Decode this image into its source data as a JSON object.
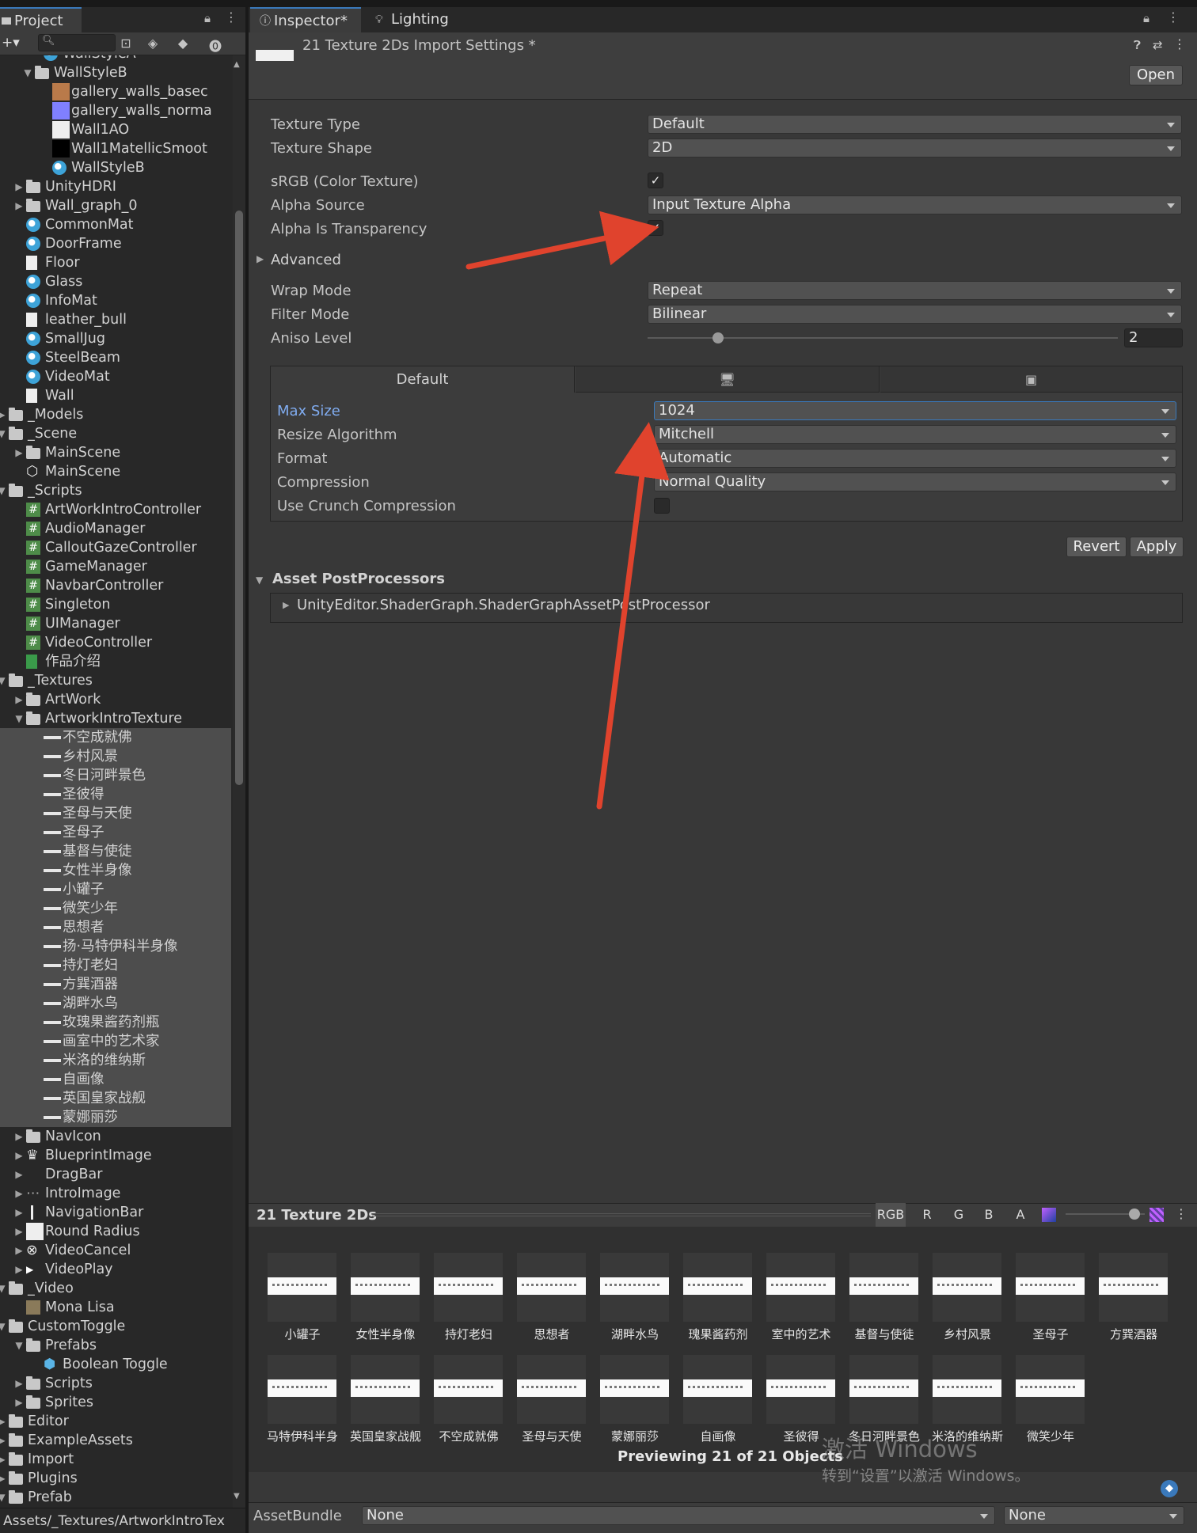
{
  "project": {
    "tab": "Project",
    "search_placeholder": "",
    "path": "Assets/_Textures/ArtworkIntroTex"
  },
  "tree": [
    {
      "label": "WallStyleA",
      "indent": 5,
      "icon": "mat",
      "arrow": ""
    },
    {
      "label": "WallStyleB",
      "indent": 4,
      "icon": "folder-open",
      "arrow": "down"
    },
    {
      "label": "gallery_walls_basec",
      "indent": 6,
      "icon": "sw-brown",
      "arrow": ""
    },
    {
      "label": "gallery_walls_norma",
      "indent": 6,
      "icon": "sw-blue",
      "arrow": ""
    },
    {
      "label": "Wall1AO",
      "indent": 6,
      "icon": "sw-white",
      "arrow": ""
    },
    {
      "label": "Wall1MatellicSmoot",
      "indent": 6,
      "icon": "sw-black",
      "arrow": ""
    },
    {
      "label": "WallStyleB",
      "indent": 6,
      "icon": "mat",
      "arrow": ""
    },
    {
      "label": "UnityHDRI",
      "indent": 3,
      "icon": "folder",
      "arrow": "right"
    },
    {
      "label": "Wall_graph_0",
      "indent": 3,
      "icon": "folder",
      "arrow": "right"
    },
    {
      "label": "CommonMat",
      "indent": 3,
      "icon": "mat",
      "arrow": ""
    },
    {
      "label": "DoorFrame",
      "indent": 3,
      "icon": "mat",
      "arrow": ""
    },
    {
      "label": "Floor",
      "indent": 3,
      "icon": "file",
      "arrow": ""
    },
    {
      "label": "Glass",
      "indent": 3,
      "icon": "mat",
      "arrow": ""
    },
    {
      "label": "InfoMat",
      "indent": 3,
      "icon": "mat",
      "arrow": ""
    },
    {
      "label": "leather_bull",
      "indent": 3,
      "icon": "file",
      "arrow": ""
    },
    {
      "label": "SmallJug",
      "indent": 3,
      "icon": "mat",
      "arrow": ""
    },
    {
      "label": "SteelBeam",
      "indent": 3,
      "icon": "mat",
      "arrow": ""
    },
    {
      "label": "VideoMat",
      "indent": 3,
      "icon": "mat",
      "arrow": ""
    },
    {
      "label": "Wall",
      "indent": 3,
      "icon": "file",
      "arrow": ""
    },
    {
      "label": "_Models",
      "indent": 1,
      "icon": "folder",
      "arrow": "right"
    },
    {
      "label": "_Scene",
      "indent": 1,
      "icon": "folder-open",
      "arrow": "down"
    },
    {
      "label": "MainScene",
      "indent": 3,
      "icon": "folder",
      "arrow": "right"
    },
    {
      "label": "MainScene",
      "indent": 3,
      "icon": "unity",
      "arrow": ""
    },
    {
      "label": "_Scripts",
      "indent": 1,
      "icon": "folder-open",
      "arrow": "down"
    },
    {
      "label": "ArtWorkIntroController",
      "indent": 3,
      "icon": "script",
      "arrow": ""
    },
    {
      "label": "AudioManager",
      "indent": 3,
      "icon": "script",
      "arrow": ""
    },
    {
      "label": "CalloutGazeController",
      "indent": 3,
      "icon": "script",
      "arrow": ""
    },
    {
      "label": "GameManager",
      "indent": 3,
      "icon": "script",
      "arrow": ""
    },
    {
      "label": "NavbarController",
      "indent": 3,
      "icon": "script",
      "arrow": ""
    },
    {
      "label": "Singleton",
      "indent": 3,
      "icon": "script",
      "arrow": ""
    },
    {
      "label": "UIManager",
      "indent": 3,
      "icon": "script",
      "arrow": ""
    },
    {
      "label": "VideoController",
      "indent": 3,
      "icon": "script",
      "arrow": ""
    },
    {
      "label": "作品介绍",
      "indent": 3,
      "icon": "sheet",
      "arrow": ""
    },
    {
      "label": "_Textures",
      "indent": 1,
      "icon": "folder-open",
      "arrow": "down"
    },
    {
      "label": "ArtWork",
      "indent": 3,
      "icon": "folder",
      "arrow": "right"
    },
    {
      "label": "ArtworkIntroTexture",
      "indent": 3,
      "icon": "folder-open",
      "arrow": "down"
    },
    {
      "label": "不空成就佛",
      "indent": 5,
      "icon": "dash",
      "arrow": "",
      "sel": true
    },
    {
      "label": "乡村风景",
      "indent": 5,
      "icon": "dash",
      "arrow": "",
      "sel": true
    },
    {
      "label": "冬日河畔景色",
      "indent": 5,
      "icon": "dash",
      "arrow": "",
      "sel": true
    },
    {
      "label": "圣彼得",
      "indent": 5,
      "icon": "dash",
      "arrow": "",
      "sel": true
    },
    {
      "label": "圣母与天使",
      "indent": 5,
      "icon": "dash",
      "arrow": "",
      "sel": true
    },
    {
      "label": "圣母子",
      "indent": 5,
      "icon": "dash",
      "arrow": "",
      "sel": true
    },
    {
      "label": "基督与使徒",
      "indent": 5,
      "icon": "dash",
      "arrow": "",
      "sel": true
    },
    {
      "label": "女性半身像",
      "indent": 5,
      "icon": "dash",
      "arrow": "",
      "sel": true
    },
    {
      "label": "小罐子",
      "indent": 5,
      "icon": "dash",
      "arrow": "",
      "sel": true
    },
    {
      "label": "微笑少年",
      "indent": 5,
      "icon": "dash",
      "arrow": "",
      "sel": true
    },
    {
      "label": "思想者",
      "indent": 5,
      "icon": "dash",
      "arrow": "",
      "sel": true
    },
    {
      "label": "扬·马特伊科半身像",
      "indent": 5,
      "icon": "dash",
      "arrow": "",
      "sel": true
    },
    {
      "label": "持灯老妇",
      "indent": 5,
      "icon": "dash",
      "arrow": "",
      "sel": true
    },
    {
      "label": "方巽酒器",
      "indent": 5,
      "icon": "dash",
      "arrow": "",
      "sel": true
    },
    {
      "label": "湖畔水鸟",
      "indent": 5,
      "icon": "dash",
      "arrow": "",
      "sel": true
    },
    {
      "label": "玫瑰果酱药剂瓶",
      "indent": 5,
      "icon": "dash",
      "arrow": "",
      "sel": true
    },
    {
      "label": "画室中的艺术家",
      "indent": 5,
      "icon": "dash",
      "arrow": "",
      "sel": true
    },
    {
      "label": "米洛的维纳斯",
      "indent": 5,
      "icon": "dash",
      "arrow": "",
      "sel": true
    },
    {
      "label": "自画像",
      "indent": 5,
      "icon": "dash",
      "arrow": "",
      "sel": true
    },
    {
      "label": "英国皇家战舰",
      "indent": 5,
      "icon": "dash",
      "arrow": "",
      "sel": true
    },
    {
      "label": "蒙娜丽莎",
      "indent": 5,
      "icon": "dash",
      "arrow": "",
      "sel": true
    },
    {
      "label": "NavIcon",
      "indent": 3,
      "icon": "folder",
      "arrow": "right"
    },
    {
      "label": "BlueprintImage",
      "indent": 3,
      "icon": "bp",
      "arrow": "right"
    },
    {
      "label": "DragBar",
      "indent": 3,
      "icon": "none",
      "arrow": "right"
    },
    {
      "label": "IntroImage",
      "indent": 3,
      "icon": "intro",
      "arrow": "right"
    },
    {
      "label": "NavigationBar",
      "indent": 3,
      "icon": "bar",
      "arrow": "right"
    },
    {
      "label": "Round Radius",
      "indent": 3,
      "icon": "sw-white",
      "arrow": "right"
    },
    {
      "label": "VideoCancel",
      "indent": 3,
      "icon": "xcircle",
      "arrow": "right"
    },
    {
      "label": "VideoPlay",
      "indent": 3,
      "icon": "play",
      "arrow": "right"
    },
    {
      "label": "_Video",
      "indent": 1,
      "icon": "folder-open",
      "arrow": "down"
    },
    {
      "label": "Mona Lisa",
      "indent": 3,
      "icon": "video",
      "arrow": ""
    },
    {
      "label": "CustomToggle",
      "indent": 1,
      "icon": "folder-open",
      "arrow": "down"
    },
    {
      "label": "Prefabs",
      "indent": 3,
      "icon": "folder-open",
      "arrow": "down"
    },
    {
      "label": "Boolean Toggle",
      "indent": 5,
      "icon": "prefab",
      "arrow": ""
    },
    {
      "label": "Scripts",
      "indent": 3,
      "icon": "folder",
      "arrow": "right"
    },
    {
      "label": "Sprites",
      "indent": 3,
      "icon": "folder",
      "arrow": "right"
    },
    {
      "label": "Editor",
      "indent": 1,
      "icon": "folder",
      "arrow": "right"
    },
    {
      "label": "ExampleAssets",
      "indent": 1,
      "icon": "folder",
      "arrow": "right"
    },
    {
      "label": "Import",
      "indent": 1,
      "icon": "folder",
      "arrow": "right"
    },
    {
      "label": "Plugins",
      "indent": 1,
      "icon": "folder",
      "arrow": "right"
    },
    {
      "label": "Prefab",
      "indent": 1,
      "icon": "folder-open",
      "arrow": "down"
    }
  ],
  "inspector": {
    "tabs": [
      "Inspector*",
      "Lighting"
    ],
    "title": "21 Texture 2Ds Import Settings *",
    "open_label": "Open",
    "texture_type_label": "Texture Type",
    "texture_type": "Default",
    "texture_shape_label": "Texture Shape",
    "texture_shape": "2D",
    "srgb_label": "sRGB (Color Texture)",
    "srgb_checked": "✓",
    "alpha_source_label": "Alpha Source",
    "alpha_source": "Input Texture Alpha",
    "alpha_transp_label": "Alpha Is Transparency",
    "alpha_transp_checked": "✓",
    "advanced_label": "Advanced",
    "wrap_mode_label": "Wrap Mode",
    "wrap_mode": "Repeat",
    "filter_mode_label": "Filter Mode",
    "filter_mode": "Bilinear",
    "aniso_label": "Aniso Level",
    "aniso_value": "2",
    "aniso_fraction": 0.15,
    "platform_default": "Default",
    "max_size_label": "Max Size",
    "max_size": "1024",
    "resize_label": "Resize Algorithm",
    "resize": "Mitchell",
    "format_label": "Format",
    "format": "Automatic",
    "compression_label": "Compression",
    "compression": "Normal Quality",
    "crunch_label": "Use Crunch Compression",
    "revert_label": "Revert",
    "apply_label": "Apply",
    "postproc_header": "Asset PostProcessors",
    "postproc_item": "UnityEditor.ShaderGraph.ShaderGraphAssetPostProcessor"
  },
  "preview": {
    "title": "21 Texture 2Ds",
    "channels": [
      "RGB",
      "R",
      "G",
      "B",
      "A"
    ],
    "row1": [
      "小罐子",
      "女性半身像",
      "持灯老妇",
      "思想者",
      "湖畔水鸟",
      "瑰果酱药剂",
      "室中的艺术",
      "基督与使徒",
      "乡村风景",
      "圣母子",
      "方巽酒器"
    ],
    "row2": [
      "马特伊科半身",
      "英国皇家战舰",
      "不空成就佛",
      "圣母与天使",
      "蒙娜丽莎",
      "自画像",
      "圣彼得",
      "冬日河畔景色",
      "米洛的维纳斯",
      "微笑少年"
    ],
    "footer": "Previewing 21 of 21 Objects"
  },
  "watermark": {
    "line1": "激活 Windows",
    "line2": "转到“设置”以激活 Windows。"
  },
  "assetbundle": {
    "label": "AssetBundle",
    "name": "None",
    "variant": "None"
  },
  "colors": {
    "accent": "#3a79bb",
    "annotation": "#e0432d"
  }
}
